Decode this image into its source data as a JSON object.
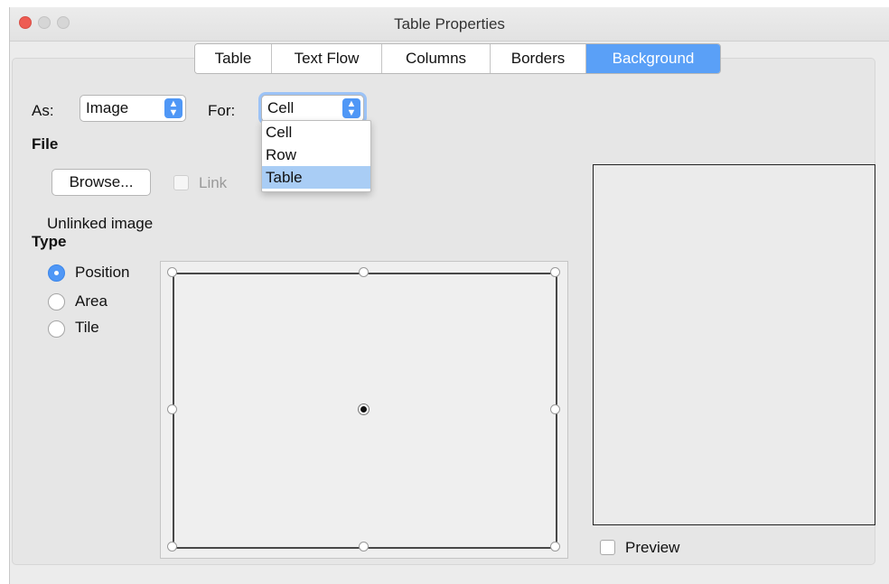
{
  "window": {
    "title": "Table Properties"
  },
  "tabs": [
    "Table",
    "Text Flow",
    "Columns",
    "Borders",
    "Background"
  ],
  "active_tab": "Background",
  "as": {
    "label": "As:",
    "value": "Image"
  },
  "for": {
    "label": "For:",
    "value": "Cell",
    "options": [
      "Cell",
      "Row",
      "Table"
    ],
    "highlighted": "Table"
  },
  "file": {
    "heading": "File",
    "browse_label": "Browse...",
    "link_label": "Link",
    "status": "Unlinked image"
  },
  "type": {
    "heading": "Type",
    "options": [
      "Position",
      "Area",
      "Tile"
    ],
    "selected": "Position"
  },
  "preview": {
    "label": "Preview"
  },
  "colors": {
    "accent": "#5aa0f7",
    "close": "#ee5c53"
  }
}
